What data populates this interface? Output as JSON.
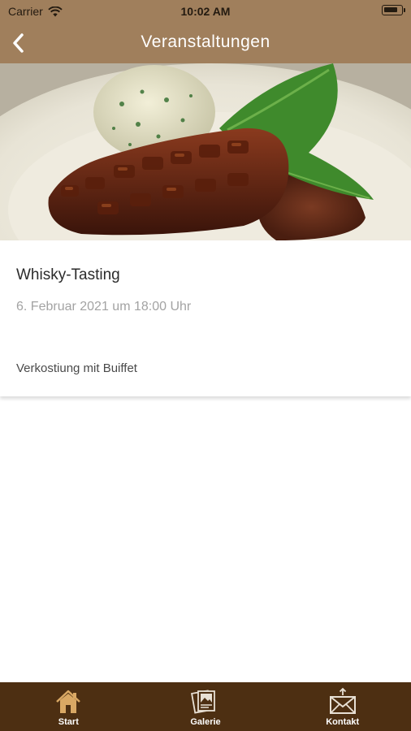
{
  "status_bar": {
    "carrier": "Carrier",
    "time": "10:02 AM"
  },
  "nav": {
    "title": "Veranstaltungen",
    "back_icon": "chevron-left-icon"
  },
  "event": {
    "title": "Whisky-Tasting",
    "date": "6. Februar 2021 um 18:00 Uhr",
    "description": "Verkostiung mit Buiffet"
  },
  "tab_bar": {
    "items": [
      {
        "label": "Start",
        "icon": "home-icon"
      },
      {
        "label": "Galerie",
        "icon": "gallery-icon"
      },
      {
        "label": "Kontakt",
        "icon": "envelope-icon"
      }
    ]
  },
  "colors": {
    "header": "#a07f5c",
    "tab_bar": "#4d2f12",
    "tab_icon": "#d9a864"
  }
}
